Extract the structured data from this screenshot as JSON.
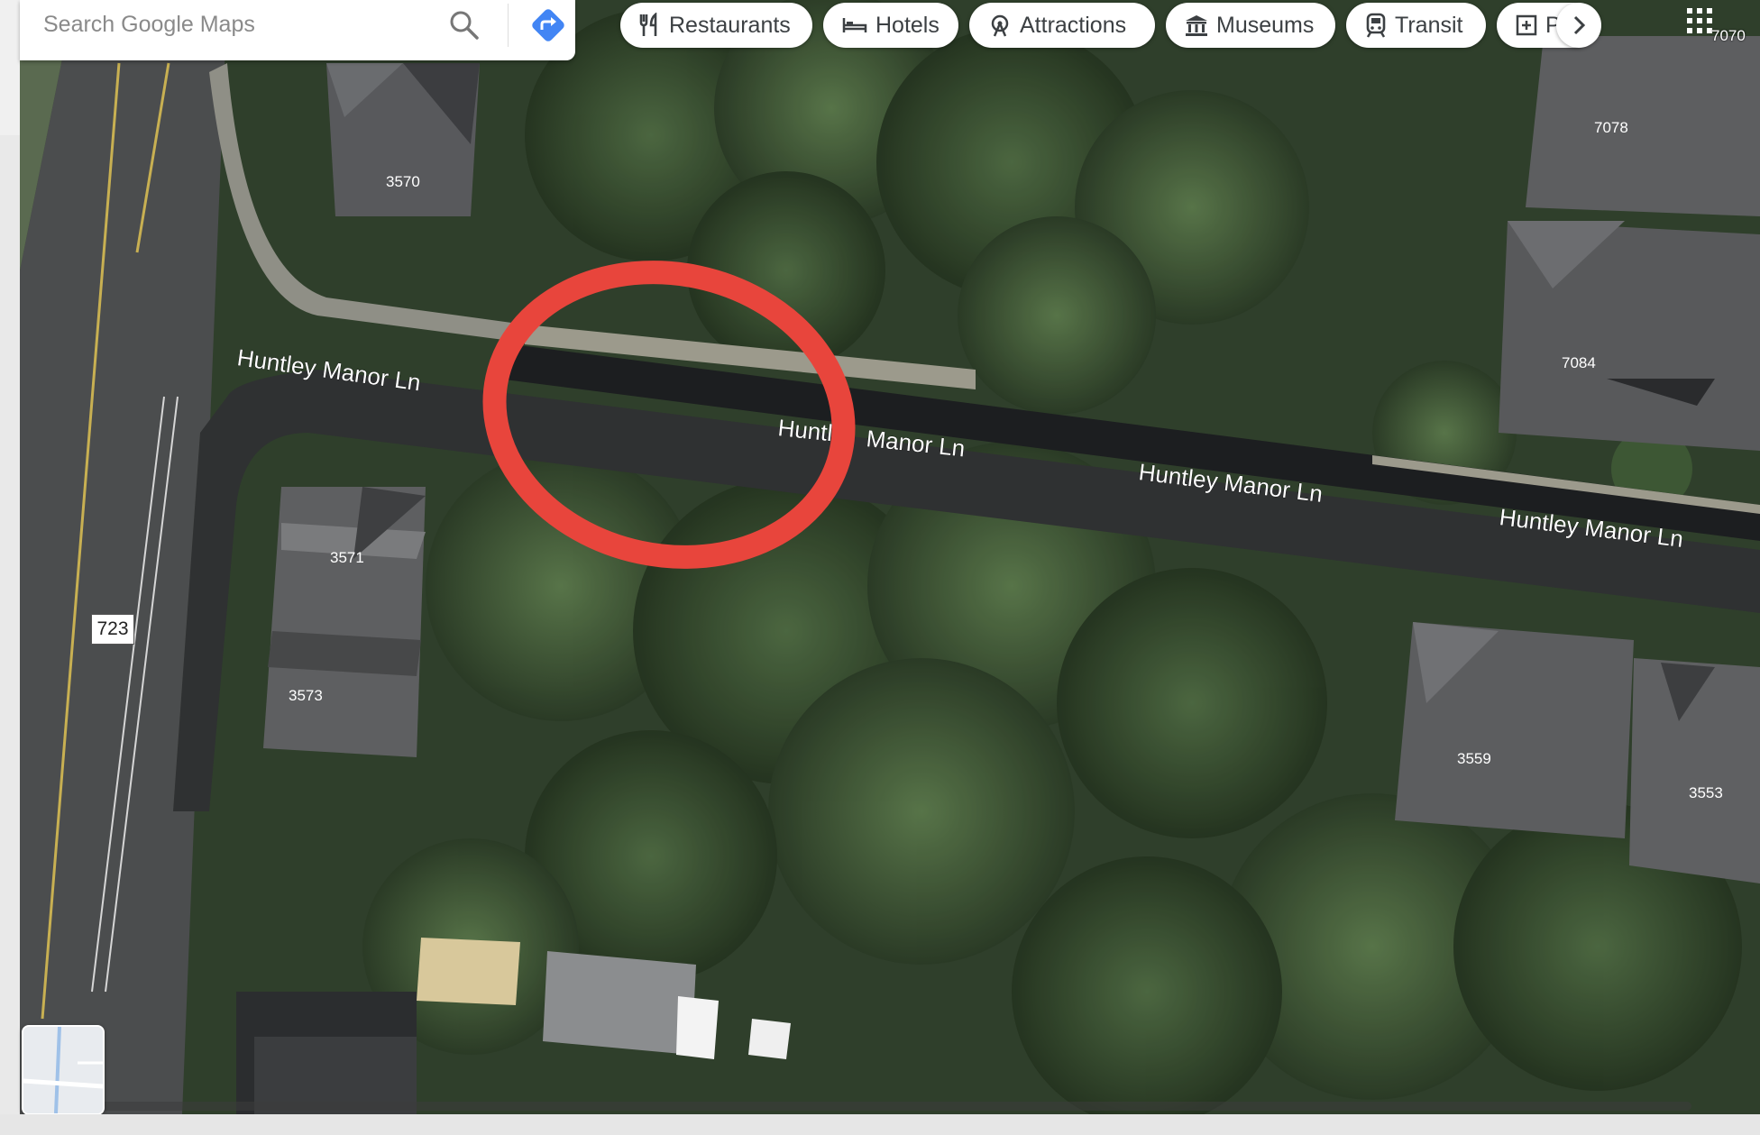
{
  "search": {
    "placeholder": "Search Google Maps"
  },
  "chips": [
    {
      "label": "Restaurants",
      "icon": "fork-knife-icon"
    },
    {
      "label": "Hotels",
      "icon": "bed-icon"
    },
    {
      "label": "Attractions",
      "icon": "ferris-wheel-icon"
    },
    {
      "label": "Museums",
      "icon": "museum-icon"
    },
    {
      "label": "Transit",
      "icon": "train-icon"
    },
    {
      "label": "Pha",
      "icon": "pharmacy-icon"
    }
  ],
  "map": {
    "view": "satellite",
    "road_labels": [
      "Huntley Manor Ln",
      "Huntl",
      "Manor Ln",
      "Huntley Manor Ln",
      "Huntley Manor Ln"
    ],
    "route_badge": "723",
    "house_numbers": [
      "3570",
      "7078",
      "7084",
      "3571",
      "3573",
      "3559",
      "3553"
    ],
    "corner_number": "7070",
    "highlight": {
      "shape": "ellipse",
      "color": "#e8453c"
    }
  },
  "colors": {
    "chip_text": "#3c4043",
    "directions_blue": "#4285f4",
    "highlight_red": "#e8453c"
  }
}
